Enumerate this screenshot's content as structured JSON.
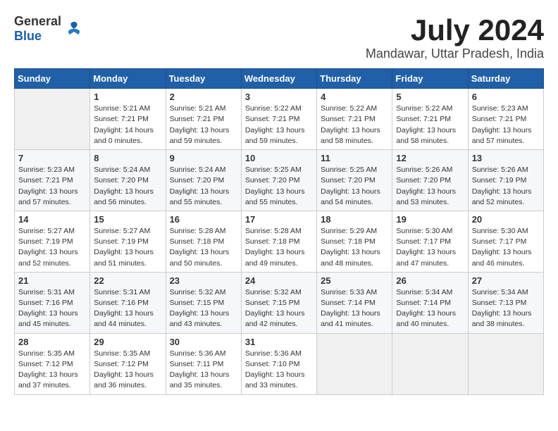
{
  "header": {
    "logo_general": "General",
    "logo_blue": "Blue",
    "month_title": "July 2024",
    "location": "Mandawar, Uttar Pradesh, India"
  },
  "weekdays": [
    "Sunday",
    "Monday",
    "Tuesday",
    "Wednesday",
    "Thursday",
    "Friday",
    "Saturday"
  ],
  "weeks": [
    [
      {
        "day": "",
        "sunrise": "",
        "sunset": "",
        "daylight": "",
        "empty": true
      },
      {
        "day": "1",
        "sunrise": "Sunrise: 5:21 AM",
        "sunset": "Sunset: 7:21 PM",
        "daylight": "Daylight: 14 hours and 0 minutes."
      },
      {
        "day": "2",
        "sunrise": "Sunrise: 5:21 AM",
        "sunset": "Sunset: 7:21 PM",
        "daylight": "Daylight: 13 hours and 59 minutes."
      },
      {
        "day": "3",
        "sunrise": "Sunrise: 5:22 AM",
        "sunset": "Sunset: 7:21 PM",
        "daylight": "Daylight: 13 hours and 59 minutes."
      },
      {
        "day": "4",
        "sunrise": "Sunrise: 5:22 AM",
        "sunset": "Sunset: 7:21 PM",
        "daylight": "Daylight: 13 hours and 58 minutes."
      },
      {
        "day": "5",
        "sunrise": "Sunrise: 5:22 AM",
        "sunset": "Sunset: 7:21 PM",
        "daylight": "Daylight: 13 hours and 58 minutes."
      },
      {
        "day": "6",
        "sunrise": "Sunrise: 5:23 AM",
        "sunset": "Sunset: 7:21 PM",
        "daylight": "Daylight: 13 hours and 57 minutes."
      }
    ],
    [
      {
        "day": "7",
        "sunrise": "Sunrise: 5:23 AM",
        "sunset": "Sunset: 7:21 PM",
        "daylight": "Daylight: 13 hours and 57 minutes."
      },
      {
        "day": "8",
        "sunrise": "Sunrise: 5:24 AM",
        "sunset": "Sunset: 7:20 PM",
        "daylight": "Daylight: 13 hours and 56 minutes."
      },
      {
        "day": "9",
        "sunrise": "Sunrise: 5:24 AM",
        "sunset": "Sunset: 7:20 PM",
        "daylight": "Daylight: 13 hours and 55 minutes."
      },
      {
        "day": "10",
        "sunrise": "Sunrise: 5:25 AM",
        "sunset": "Sunset: 7:20 PM",
        "daylight": "Daylight: 13 hours and 55 minutes."
      },
      {
        "day": "11",
        "sunrise": "Sunrise: 5:25 AM",
        "sunset": "Sunset: 7:20 PM",
        "daylight": "Daylight: 13 hours and 54 minutes."
      },
      {
        "day": "12",
        "sunrise": "Sunrise: 5:26 AM",
        "sunset": "Sunset: 7:20 PM",
        "daylight": "Daylight: 13 hours and 53 minutes."
      },
      {
        "day": "13",
        "sunrise": "Sunrise: 5:26 AM",
        "sunset": "Sunset: 7:19 PM",
        "daylight": "Daylight: 13 hours and 52 minutes."
      }
    ],
    [
      {
        "day": "14",
        "sunrise": "Sunrise: 5:27 AM",
        "sunset": "Sunset: 7:19 PM",
        "daylight": "Daylight: 13 hours and 52 minutes."
      },
      {
        "day": "15",
        "sunrise": "Sunrise: 5:27 AM",
        "sunset": "Sunset: 7:19 PM",
        "daylight": "Daylight: 13 hours and 51 minutes."
      },
      {
        "day": "16",
        "sunrise": "Sunrise: 5:28 AM",
        "sunset": "Sunset: 7:18 PM",
        "daylight": "Daylight: 13 hours and 50 minutes."
      },
      {
        "day": "17",
        "sunrise": "Sunrise: 5:28 AM",
        "sunset": "Sunset: 7:18 PM",
        "daylight": "Daylight: 13 hours and 49 minutes."
      },
      {
        "day": "18",
        "sunrise": "Sunrise: 5:29 AM",
        "sunset": "Sunset: 7:18 PM",
        "daylight": "Daylight: 13 hours and 48 minutes."
      },
      {
        "day": "19",
        "sunrise": "Sunrise: 5:30 AM",
        "sunset": "Sunset: 7:17 PM",
        "daylight": "Daylight: 13 hours and 47 minutes."
      },
      {
        "day": "20",
        "sunrise": "Sunrise: 5:30 AM",
        "sunset": "Sunset: 7:17 PM",
        "daylight": "Daylight: 13 hours and 46 minutes."
      }
    ],
    [
      {
        "day": "21",
        "sunrise": "Sunrise: 5:31 AM",
        "sunset": "Sunset: 7:16 PM",
        "daylight": "Daylight: 13 hours and 45 minutes."
      },
      {
        "day": "22",
        "sunrise": "Sunrise: 5:31 AM",
        "sunset": "Sunset: 7:16 PM",
        "daylight": "Daylight: 13 hours and 44 minutes."
      },
      {
        "day": "23",
        "sunrise": "Sunrise: 5:32 AM",
        "sunset": "Sunset: 7:15 PM",
        "daylight": "Daylight: 13 hours and 43 minutes."
      },
      {
        "day": "24",
        "sunrise": "Sunrise: 5:32 AM",
        "sunset": "Sunset: 7:15 PM",
        "daylight": "Daylight: 13 hours and 42 minutes."
      },
      {
        "day": "25",
        "sunrise": "Sunrise: 5:33 AM",
        "sunset": "Sunset: 7:14 PM",
        "daylight": "Daylight: 13 hours and 41 minutes."
      },
      {
        "day": "26",
        "sunrise": "Sunrise: 5:34 AM",
        "sunset": "Sunset: 7:14 PM",
        "daylight": "Daylight: 13 hours and 40 minutes."
      },
      {
        "day": "27",
        "sunrise": "Sunrise: 5:34 AM",
        "sunset": "Sunset: 7:13 PM",
        "daylight": "Daylight: 13 hours and 38 minutes."
      }
    ],
    [
      {
        "day": "28",
        "sunrise": "Sunrise: 5:35 AM",
        "sunset": "Sunset: 7:12 PM",
        "daylight": "Daylight: 13 hours and 37 minutes."
      },
      {
        "day": "29",
        "sunrise": "Sunrise: 5:35 AM",
        "sunset": "Sunset: 7:12 PM",
        "daylight": "Daylight: 13 hours and 36 minutes."
      },
      {
        "day": "30",
        "sunrise": "Sunrise: 5:36 AM",
        "sunset": "Sunset: 7:11 PM",
        "daylight": "Daylight: 13 hours and 35 minutes."
      },
      {
        "day": "31",
        "sunrise": "Sunrise: 5:36 AM",
        "sunset": "Sunset: 7:10 PM",
        "daylight": "Daylight: 13 hours and 33 minutes."
      },
      {
        "day": "",
        "sunrise": "",
        "sunset": "",
        "daylight": "",
        "empty": true
      },
      {
        "day": "",
        "sunrise": "",
        "sunset": "",
        "daylight": "",
        "empty": true
      },
      {
        "day": "",
        "sunrise": "",
        "sunset": "",
        "daylight": "",
        "empty": true
      }
    ]
  ]
}
